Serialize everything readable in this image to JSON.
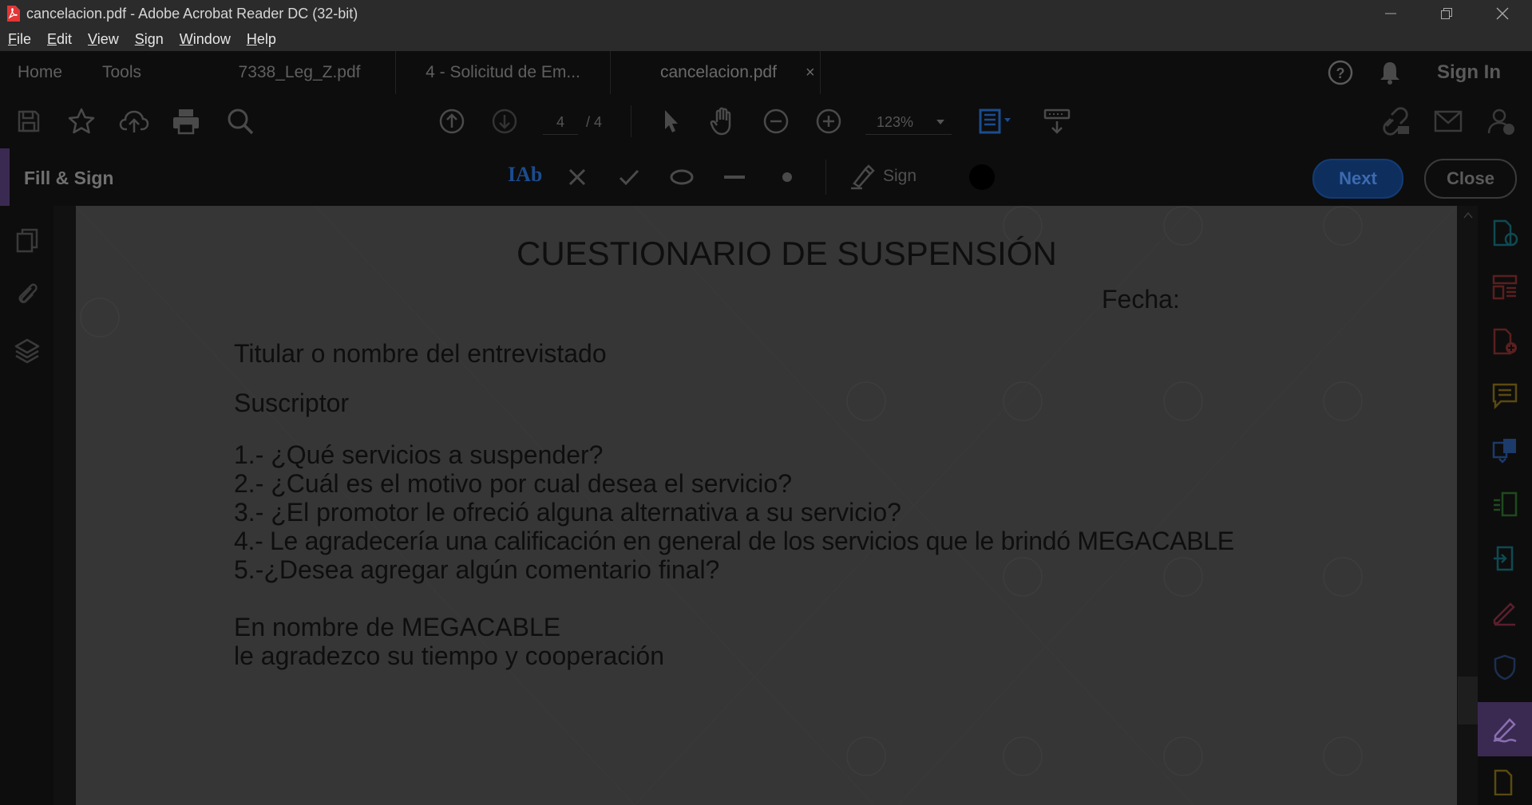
{
  "window": {
    "title": "cancelacion.pdf - Adobe Acrobat Reader DC (32-bit)",
    "minimize_icon": "minimize-icon",
    "restore_icon": "restore-icon",
    "close_icon": "close-icon"
  },
  "menu": [
    "File",
    "Edit",
    "View",
    "Sign",
    "Window",
    "Help"
  ],
  "tabs": {
    "home": "Home",
    "tools": "Tools",
    "docs": [
      "7338_Leg_Z.pdf",
      "4 - Solicitud de Em...",
      "cancelacion.pdf"
    ],
    "close_glyph": "×",
    "sign_in": "Sign In"
  },
  "toolbar": {
    "page_current": "4",
    "page_total": "/ 4",
    "zoom": "123%"
  },
  "fill_sign": {
    "title": "Fill & Sign",
    "text_tool": "IAb",
    "sign_label": "Sign",
    "next_label": "Next",
    "close_label": "Close"
  },
  "document": {
    "heading": "CUESTIONARIO DE SUSPENSIÓN",
    "date_label": "Fecha:",
    "field_titular": "Titular o nombre del entrevistado",
    "field_suscriptor": "Suscriptor",
    "questions": [
      "1.- ¿Qué servicios a suspender?",
      "2.- ¿Cuál es el motivo por cual desea el servicio?",
      "3.- ¿El promotor le ofreció alguna alternativa a su servicio?",
      "4.- Le agradecería una calificación en general de los servicios que le brindó MEGACABLE",
      "5.-¿Desea agregar algún comentario final?"
    ],
    "closing_line1": "En nombre de MEGACABLE",
    "closing_line2": "le agradezco su tiempo y cooperación"
  },
  "colors": {
    "accent_blue": "#1c5fbf",
    "fill_sign_purple": "#5a3a85",
    "page_dimmed": "#363636"
  }
}
